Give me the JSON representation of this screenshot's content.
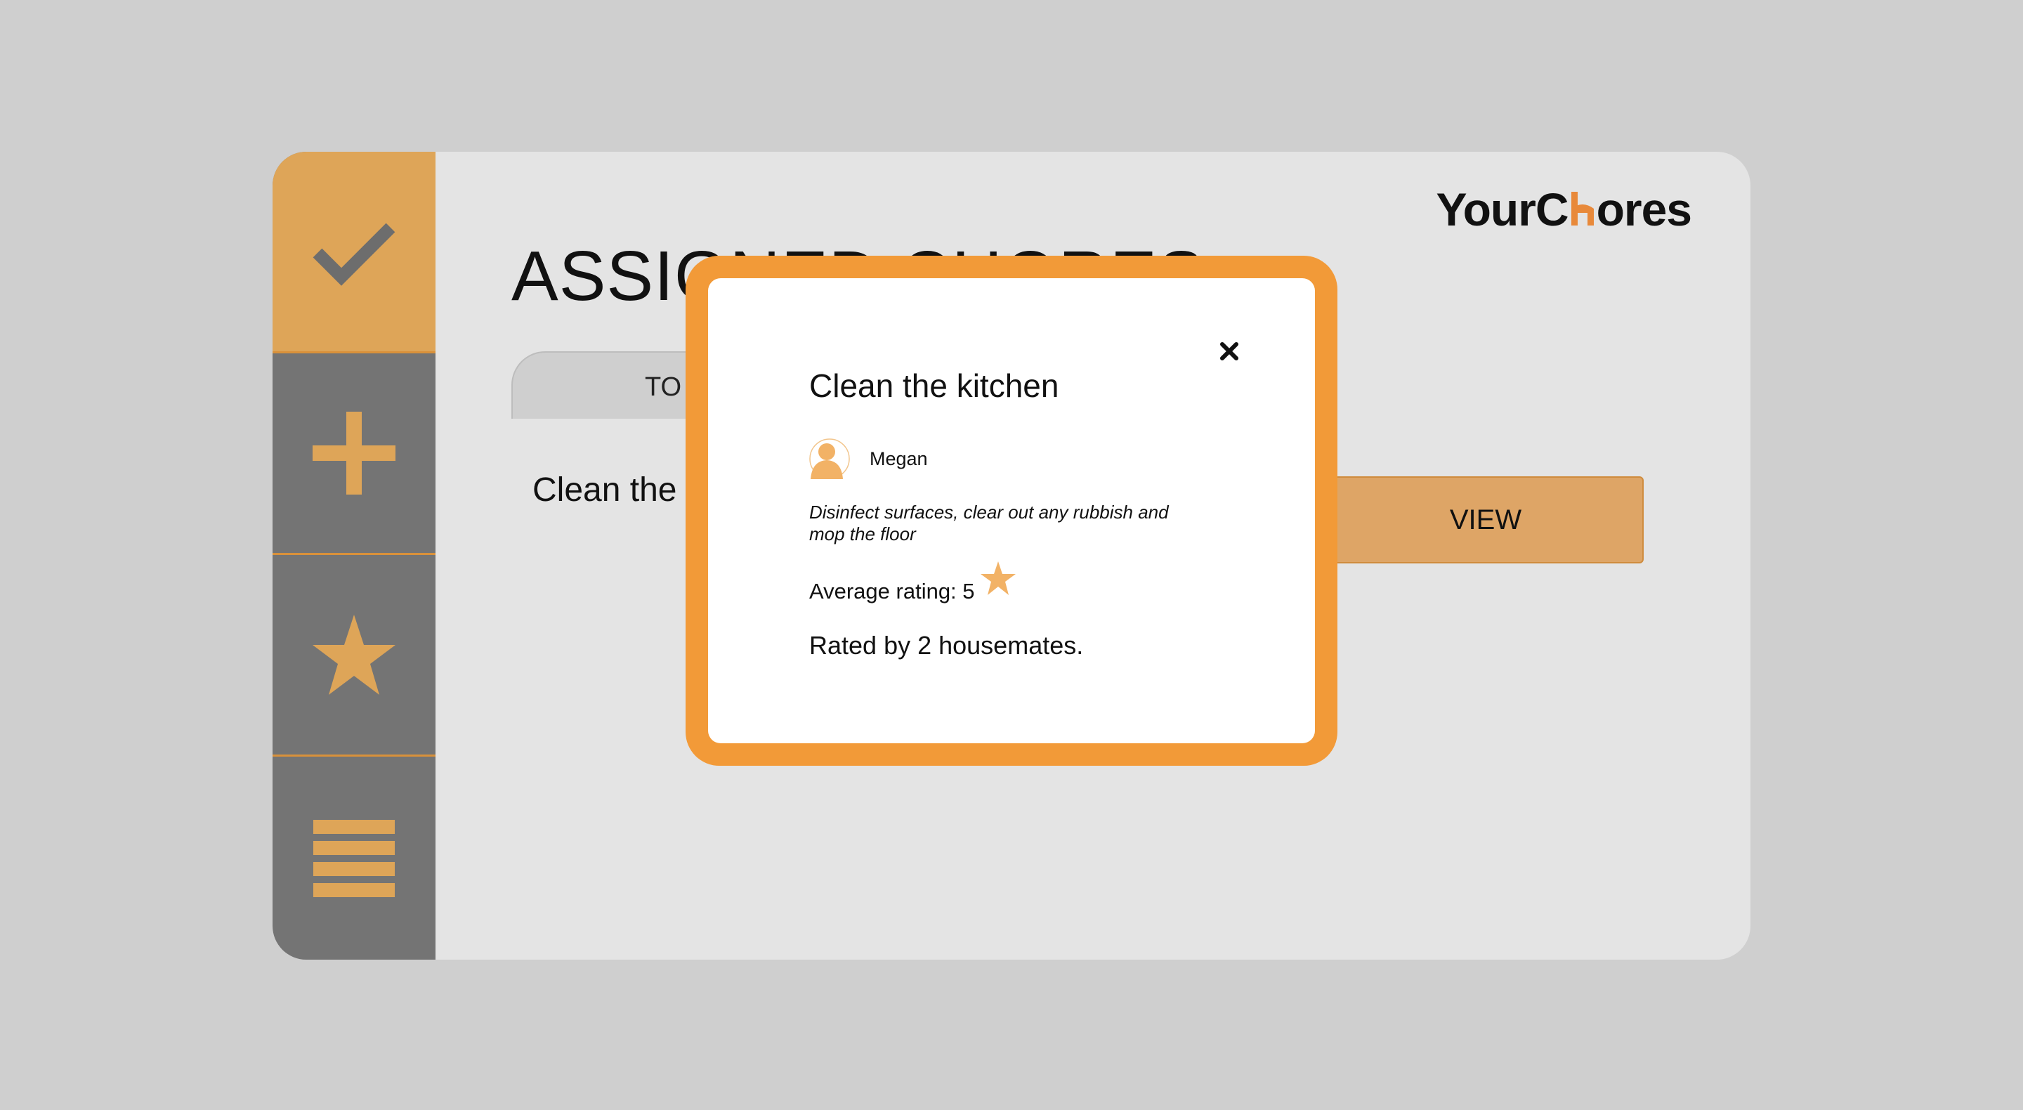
{
  "app": {
    "brand": {
      "text_before": "YourC",
      "text_after": "ores",
      "icon": "house-icon"
    },
    "page_title": "ASSIGNED CHORES",
    "tab_label": "TO",
    "chore_row": {
      "title": "Clean the",
      "view_label": "VIEW"
    }
  },
  "sidebar": {
    "items": [
      {
        "icon": "checkmark-icon",
        "active": true
      },
      {
        "icon": "plus-icon",
        "active": false
      },
      {
        "icon": "star-icon",
        "active": false
      },
      {
        "icon": "menu-icon",
        "active": false
      }
    ]
  },
  "modal": {
    "title": "Clean the kitchen",
    "close_icon": "close-icon",
    "assignee": {
      "name": "Megan",
      "icon": "user-avatar-icon"
    },
    "description": "Disinfect surfaces, clear out any rubbish and mop the floor",
    "rating_label": "Average rating: 5",
    "rating_value": 5,
    "rated_by": "Rated by 2 housemates."
  },
  "colors": {
    "accent": "#f29a38",
    "accent_soft": "#dea558",
    "sidebar": "#747474",
    "panel": "#e4e4e4",
    "background": "#cfcfcf"
  }
}
